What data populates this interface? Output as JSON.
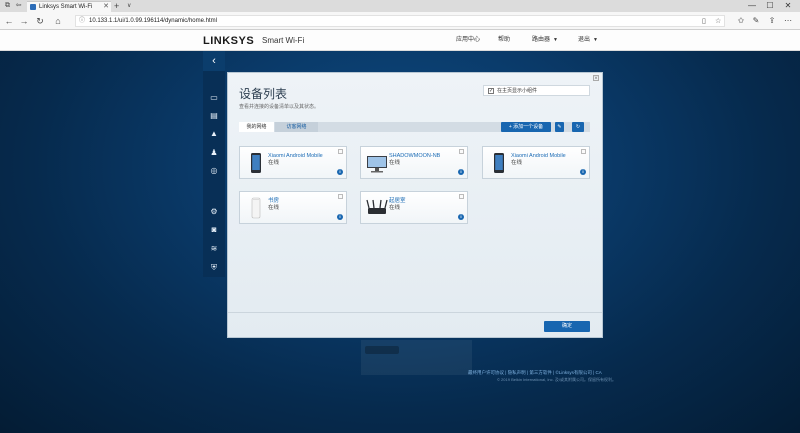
{
  "browser": {
    "tab_title": "Linksys Smart Wi-Fi",
    "tab_close_icon": "close-icon",
    "new_tab_label": "+",
    "tab_menu_label": "∨",
    "url": "10.133.1.1/ui/1.0.99.196114/dynamic/home.html",
    "window_controls": {
      "minimize": "—",
      "maximize": "☐",
      "close": "✕"
    },
    "nav": {
      "back": "←",
      "forward": "→",
      "reload": "↻",
      "home": "⌂"
    }
  },
  "header": {
    "logo": "LINKSYS",
    "logo_sub": "Smart Wi-Fi",
    "links": {
      "app_center": "应用中心",
      "help": "帮助",
      "router": "路由器",
      "logout": "退出"
    }
  },
  "sidebar": {
    "back_icon": "chevron-left-icon",
    "items": [
      {
        "icon": "router-icon",
        "glyph": "▭"
      },
      {
        "icon": "devices-icon",
        "glyph": "▤"
      },
      {
        "icon": "alert-icon",
        "glyph": "▲"
      },
      {
        "icon": "parental-icon",
        "glyph": "♟"
      },
      {
        "icon": "speed-icon",
        "glyph": "◎"
      },
      {
        "icon": "connectivity-icon",
        "glyph": "⚙"
      },
      {
        "icon": "media-icon",
        "glyph": "◙"
      },
      {
        "icon": "wireless-icon",
        "glyph": "≋"
      },
      {
        "icon": "security-icon",
        "glyph": "⛨"
      }
    ]
  },
  "dialog": {
    "title": "设备列表",
    "subtitle": "查看并连接的设备清单以及其状态。",
    "guest_option": {
      "label": "在主页显示小组件",
      "checked": true
    },
    "tabs": {
      "my_network": "我的网络",
      "guest_network": "访客网络"
    },
    "add_device_label": "+ 添加一个设备",
    "edit_icon": "edit-icon",
    "refresh_icon": "refresh-icon",
    "devices": [
      {
        "name": "Xiaomi Android Mobile",
        "status": "在线",
        "type": "phone"
      },
      {
        "name": "SHADOWMOON-NB",
        "status": "在线",
        "type": "desktop"
      },
      {
        "name": "Xiaomi Android Mobile",
        "status": "在线",
        "type": "phone"
      },
      {
        "name": "书房",
        "status": "在线",
        "type": "node"
      },
      {
        "name": "起居室",
        "status": "在线",
        "type": "router"
      }
    ],
    "ok_label": "确定"
  },
  "footer": {
    "links": "最终用户许可协议  |  隐私声明  |  第三方软件  |  ©Linksys有限公司  |  CA",
    "copyright": "© 2019 Belkin International, Inc. 及/或其附属公司。保留所有权利。"
  },
  "colors": {
    "accent": "#1866b0",
    "background": "#0a3a69",
    "sidebar": "#082f56"
  }
}
